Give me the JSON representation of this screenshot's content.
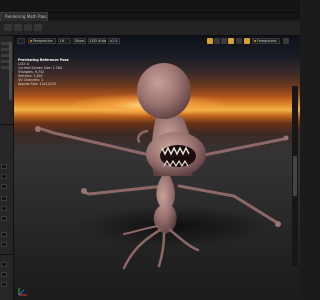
{
  "window": {
    "tab_label": "Rendering Math Pass",
    "tab_close": "×"
  },
  "viewport": {
    "toolbar": {
      "perspective_label": "Perspective",
      "lit_label": "Lit",
      "show_label": "Show",
      "lod_label": "LOD Auto",
      "speed_label": "x1.0",
      "forward_label": "Foreground"
    },
    "stats": {
      "heading": "Previewing Reference Pose",
      "lines": [
        "LOD: 0",
        "Current Screen Size: 1.164",
        "Triangles: 9,752",
        "Vertices: 7,491",
        "UV Channels: 1",
        "Approx Size: 14x12x33"
      ]
    }
  },
  "colors": {
    "accent": "#e0a020",
    "sky_glow": "#f2b24a",
    "panel_bg": "#262626"
  },
  "icons": {
    "tab_close": "close-icon",
    "viewport_menu": "menu-icon",
    "axis": "axis-gizmo-icon"
  }
}
